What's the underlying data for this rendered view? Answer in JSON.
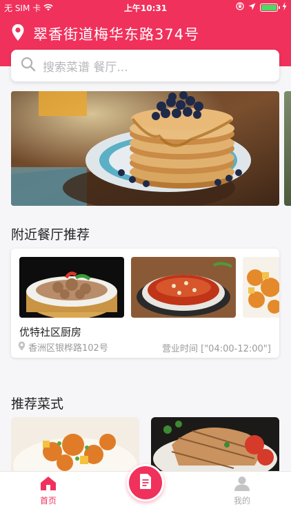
{
  "status_bar": {
    "carrier": "无 SIM 卡",
    "time": "上午10:31"
  },
  "location": {
    "address": "翠香街道梅华东路374号"
  },
  "search": {
    "placeholder": "搜索菜谱 餐厅..."
  },
  "sections": {
    "nearby_title": "附近餐厅推荐",
    "recommended_title": "推荐菜式"
  },
  "restaurant": {
    "name": "优特社区厨房",
    "address": "香洲区银桦路102号",
    "hours": "营业时间 [\"04:00-12:00\"]"
  },
  "tabbar": {
    "home_label": "首页",
    "mine_label": "我的"
  },
  "colors": {
    "accent": "#f0315c",
    "battery": "#4cd964"
  }
}
